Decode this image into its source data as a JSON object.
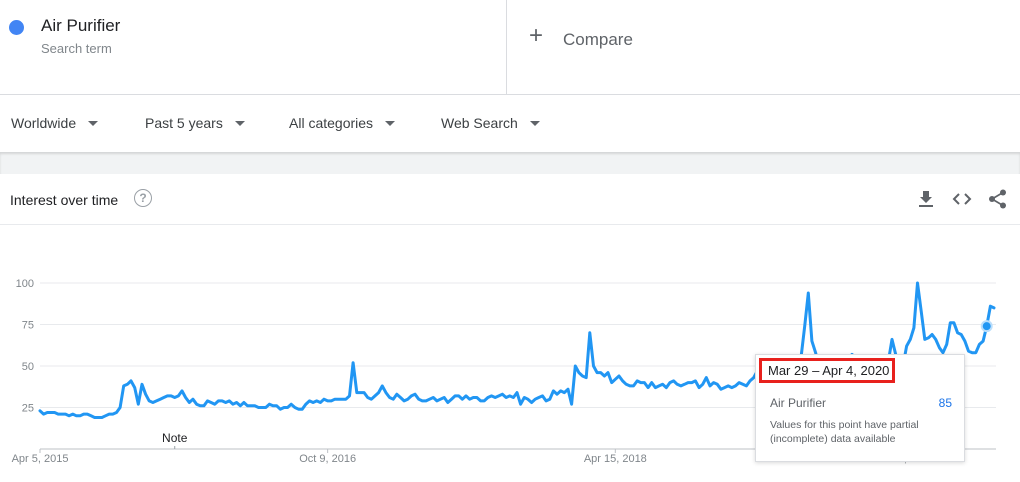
{
  "search": {
    "term": "Air Purifier",
    "subtitle": "Search term",
    "dot_color": "#4285f4"
  },
  "compare": {
    "label": "Compare"
  },
  "filters": [
    {
      "label": "Worldwide"
    },
    {
      "label": "Past 5 years"
    },
    {
      "label": "All categories"
    },
    {
      "label": "Web Search"
    }
  ],
  "card": {
    "title": "Interest over time",
    "help_icon": "?",
    "actions": [
      "download-icon",
      "embed-icon",
      "share-icon"
    ]
  },
  "chart_data": {
    "type": "line",
    "ylim": [
      0,
      100
    ],
    "y_ticks": [
      "100",
      "75",
      "50",
      "25"
    ],
    "x_ticks": [
      {
        "label": "Apr 5, 2015",
        "week": 0
      },
      {
        "label": "Oct 9, 2016",
        "week": 79
      },
      {
        "label": "Apr 15, 2018",
        "week": 158
      },
      {
        "label": "Oct 20, 2019",
        "week": 237
      }
    ],
    "note_label": "Note",
    "note_week": 37,
    "grid": true,
    "color": "#2196f3",
    "series": [
      {
        "name": "Air Purifier",
        "values": [
          23,
          21,
          22,
          22,
          22,
          21,
          21,
          21,
          20,
          21,
          20,
          20,
          21,
          21,
          20,
          19,
          19,
          19,
          20,
          21,
          21,
          22,
          25,
          38,
          39,
          41,
          37,
          27,
          39,
          33,
          29,
          28,
          29,
          30,
          31,
          32,
          32,
          31,
          32,
          35,
          31,
          28,
          30,
          27,
          26,
          26,
          29,
          28,
          27,
          29,
          29,
          28,
          29,
          27,
          28,
          26,
          28,
          26,
          26,
          26,
          25,
          25,
          25,
          27,
          26,
          26,
          24,
          25,
          25,
          27,
          25,
          24,
          24,
          27,
          29,
          28,
          29,
          28,
          30,
          29,
          29,
          30,
          30,
          30,
          30,
          32,
          52,
          34,
          34,
          34,
          31,
          30,
          32,
          34,
          38,
          34,
          31,
          30,
          33,
          31,
          29,
          30,
          32,
          33,
          30,
          29,
          29,
          30,
          31,
          29,
          30,
          31,
          28,
          30,
          32,
          32,
          30,
          32,
          30,
          31,
          31,
          29,
          29,
          31,
          32,
          31,
          32,
          33,
          31,
          32,
          31,
          34,
          27,
          31,
          30,
          28,
          30,
          31,
          32,
          29,
          30,
          35,
          33,
          35,
          34,
          36,
          27,
          50,
          46,
          44,
          43,
          70,
          50,
          46,
          46,
          44,
          46,
          40,
          42,
          44,
          41,
          39,
          38,
          38,
          41,
          40,
          40,
          37,
          40,
          37,
          38,
          39,
          37,
          40,
          41,
          39,
          38,
          39,
          40,
          40,
          41,
          37,
          39,
          43,
          38,
          40,
          39,
          36,
          37,
          38,
          37,
          38,
          40,
          39,
          38,
          41,
          43,
          47,
          38,
          40,
          38,
          39,
          40,
          39,
          40,
          41,
          45,
          46,
          48,
          55,
          74,
          94,
          65,
          58,
          49,
          48,
          47,
          53,
          52,
          50,
          49,
          50,
          54,
          57,
          55,
          56,
          55,
          52,
          50,
          48,
          49,
          51,
          50,
          53,
          66,
          57,
          52,
          50,
          62,
          66,
          73,
          100,
          83,
          66,
          67,
          69,
          66,
          61,
          58,
          63,
          76,
          76,
          70,
          69,
          65,
          59,
          58,
          58,
          63,
          65,
          74,
          86,
          85
        ]
      }
    ],
    "tooltip_index": 260
  },
  "tooltip": {
    "date": "Mar 29 – Apr 4, 2020",
    "series": "Air Purifier",
    "value": "85",
    "note": "Values for this point have partial (incomplete) data available"
  }
}
